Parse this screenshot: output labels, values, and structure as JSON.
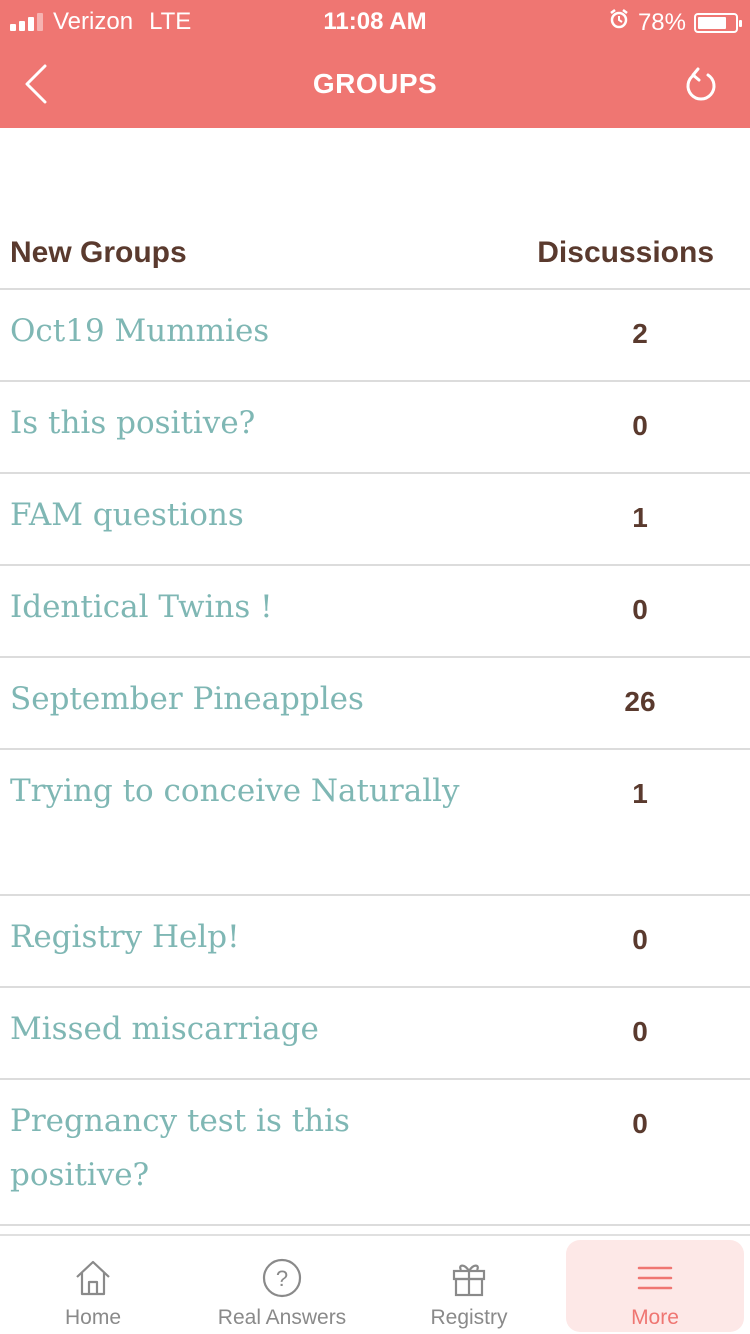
{
  "status_bar": {
    "carrier": "Verizon",
    "network": "LTE",
    "time": "11:08 AM",
    "battery": "78%",
    "battery_level": 0.78
  },
  "header": {
    "title": "GROUPS",
    "back_icon": "chevron-left-icon",
    "refresh_icon": "refresh-icon"
  },
  "table": {
    "col_name": "New Groups",
    "col_discussions": "Discussions",
    "rows": [
      {
        "name": "Oct19 Mummies",
        "discussions": "2"
      },
      {
        "name": "Is this positive?",
        "discussions": "0"
      },
      {
        "name": "FAM questions",
        "discussions": "1"
      },
      {
        "name": "Identical Twins !",
        "discussions": "0"
      },
      {
        "name": "September Pineapples",
        "discussions": "26"
      },
      {
        "name": "Trying to conceive Naturally",
        "discussions": "1"
      },
      {
        "name": "Registry Help!",
        "discussions": "0"
      },
      {
        "name": "Missed miscarriage",
        "discussions": "0"
      },
      {
        "name": "Pregnancy test is this positive?",
        "discussions": "0"
      }
    ]
  },
  "tabbar": {
    "home": "Home",
    "real_answers": "Real Answers",
    "registry": "Registry",
    "more": "More",
    "active": "More"
  },
  "colors": {
    "brand": "#ef7672",
    "group_name": "#7fb7b4",
    "text_dark": "#5a3a2e"
  }
}
